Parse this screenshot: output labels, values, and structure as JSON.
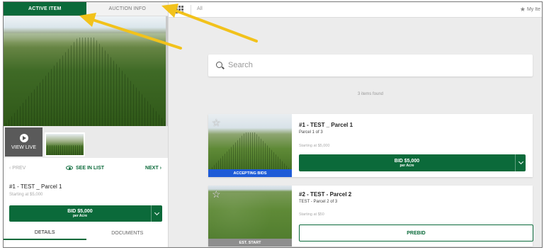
{
  "left_panel": {
    "tabs": [
      {
        "label": "ACTIVE ITEM",
        "active": true
      },
      {
        "label": "AUCTION INFO",
        "active": false
      }
    ],
    "view_live_label": "VIEW LIVE",
    "nav": {
      "prev_label": "PREV",
      "see_in_list_label": "SEE IN LIST",
      "next_label": "NEXT"
    },
    "item_title": "#1 - TEST _ Parcel 1",
    "item_starting": "Starting at $5,000",
    "bid_button": {
      "label": "BID $5,000",
      "sub": "per Acre"
    },
    "detail_tabs": [
      {
        "label": "DETAILS",
        "active": true
      },
      {
        "label": "DOCUMENTS",
        "active": false
      }
    ]
  },
  "top_bar": {
    "filter_label": "All",
    "my_items_label": "My Ite"
  },
  "main": {
    "search": {
      "placeholder": "Search",
      "value": ""
    },
    "items_found": "3 items found",
    "cards": [
      {
        "title": "#1 - TEST _ Parcel 1",
        "subtitle": "Parcel 1 of 3",
        "starting": "Starting at $5,000",
        "status": "ACCEPTING BIDS",
        "button": {
          "label": "BID $5,000",
          "sub": "per Acre"
        }
      },
      {
        "title": "#2 - TEST - Parcel 2",
        "subtitle": "TEST - Parcel 2 of 3",
        "starting": "Starting at $50",
        "status": "EST. START",
        "button": {
          "label": "PREBID"
        }
      }
    ]
  },
  "colors": {
    "brand_green": "#0b6a3a",
    "accepting_blue": "#1e5bd7",
    "annotation_yellow": "#f2c21b"
  }
}
